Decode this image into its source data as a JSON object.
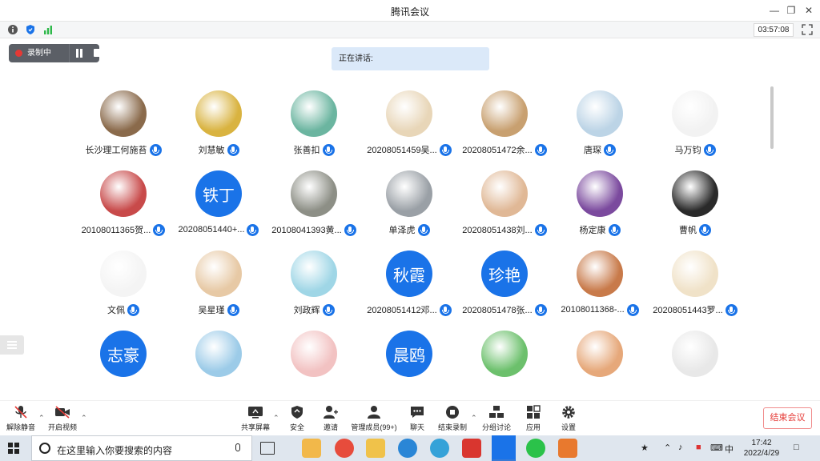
{
  "window": {
    "title": "腾讯会议"
  },
  "infobar": {
    "timer": "03:57:08"
  },
  "recording": {
    "label": "录制中"
  },
  "speaking": {
    "label": "正在讲话:"
  },
  "participants": [
    {
      "name": "长沙理工何施苔",
      "avatar_type": "pic",
      "color": "#8a6a4b"
    },
    {
      "name": "刘慧敏",
      "avatar_type": "pic",
      "color": "#d9b340"
    },
    {
      "name": "张善扣",
      "avatar_type": "pic",
      "color": "#6bb5a0"
    },
    {
      "name": "20208051459吴...",
      "avatar_type": "pic",
      "color": "#e8d6b8"
    },
    {
      "name": "20208051472余...",
      "avatar_type": "pic",
      "color": "#c8a070"
    },
    {
      "name": "唐琛",
      "avatar_type": "pic",
      "color": "#bcd4e6"
    },
    {
      "name": "马万钧",
      "avatar_type": "pic",
      "color": "#f2f2f2"
    },
    {
      "name": "20108011365贺...",
      "avatar_type": "pic",
      "color": "#c84a4a"
    },
    {
      "name": "20208051440+...",
      "avatar_type": "text",
      "text": "铁丁"
    },
    {
      "name": "20108041393黄...",
      "avatar_type": "pic",
      "color": "#8d8f86"
    },
    {
      "name": "单泽虎",
      "avatar_type": "pic",
      "color": "#9aa0a6"
    },
    {
      "name": "20208051438刘...",
      "avatar_type": "pic",
      "color": "#e0b896"
    },
    {
      "name": "杨定康",
      "avatar_type": "pic",
      "color": "#7b4a9e"
    },
    {
      "name": "曹帆",
      "avatar_type": "pic",
      "color": "#2a2a2a"
    },
    {
      "name": "文佩",
      "avatar_type": "pic",
      "color": "#f4f4f4"
    },
    {
      "name": "吴星瑾",
      "avatar_type": "pic",
      "color": "#e7c9a5"
    },
    {
      "name": "刘政辉",
      "avatar_type": "pic",
      "color": "#9fd6e6"
    },
    {
      "name": "20208051412邓...",
      "avatar_type": "text",
      "text": "秋霞"
    },
    {
      "name": "20208051478张...",
      "avatar_type": "text",
      "text": "珍艳"
    },
    {
      "name": "20108011368-...",
      "avatar_type": "pic",
      "color": "#c87a4a"
    },
    {
      "name": "20208051443罗...",
      "avatar_type": "pic",
      "color": "#f0e2c8"
    },
    {
      "name": "",
      "avatar_type": "text",
      "text": "志豪"
    },
    {
      "name": "",
      "avatar_type": "pic",
      "color": "#9ccbe8"
    },
    {
      "name": "",
      "avatar_type": "pic",
      "color": "#f2c2c2"
    },
    {
      "name": "",
      "avatar_type": "text",
      "text": "晨鸥"
    },
    {
      "name": "",
      "avatar_type": "pic",
      "color": "#6cc06c"
    },
    {
      "name": "",
      "avatar_type": "pic",
      "color": "#e6a87a"
    },
    {
      "name": "",
      "avatar_type": "pic",
      "color": "#e8e8e8"
    }
  ],
  "toolbar": {
    "unmute": "解除静音",
    "start_video": "开启视频",
    "share_screen": "共享屏幕",
    "security": "安全",
    "invite": "邀请",
    "manage_members": "管理成员(99+)",
    "chat": "聊天",
    "end_recording": "结束录制",
    "breakout": "分组讨论",
    "apps": "应用",
    "settings": "设置",
    "end_meeting": "结束会议"
  },
  "taskbar": {
    "search_placeholder": "在这里输入你要搜索的内容",
    "time": "17:42",
    "date": "2022/4/29",
    "ime": "中"
  },
  "colors": {
    "accent": "#1a73e8",
    "end_red": "#e53935"
  }
}
